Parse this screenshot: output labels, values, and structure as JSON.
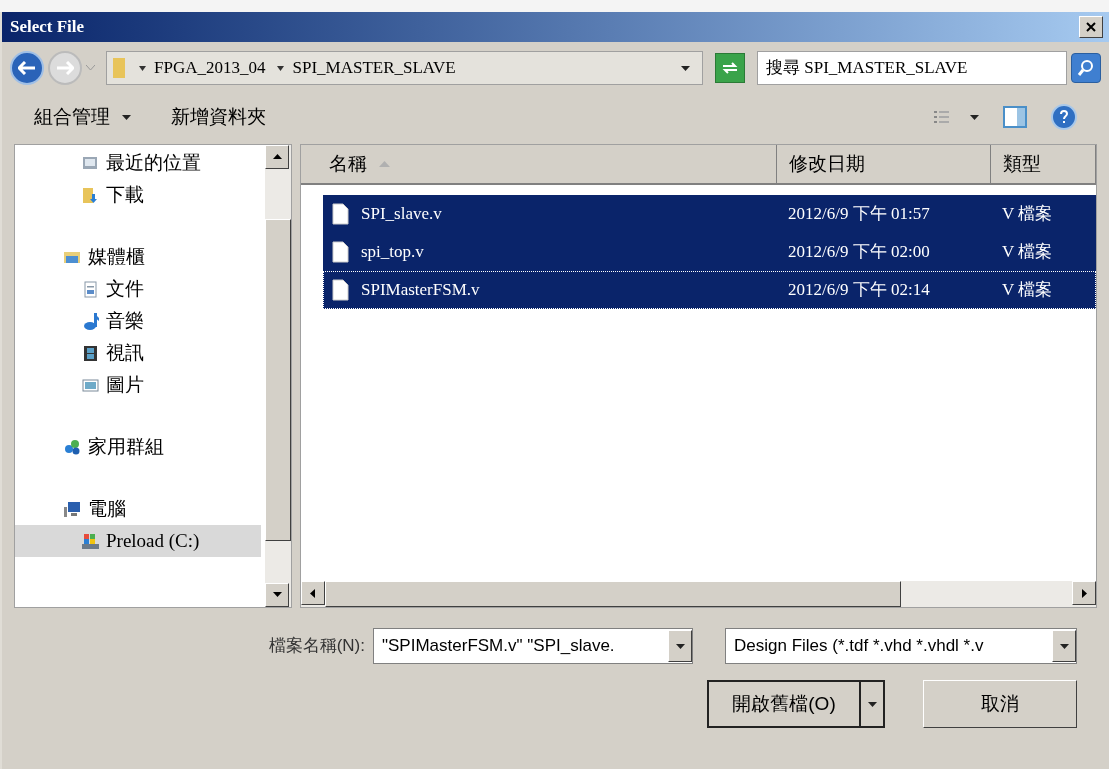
{
  "window": {
    "title": "Select File"
  },
  "address": {
    "path": [
      "FPGA_2013_04",
      "SPI_MASTER_SLAVE"
    ],
    "search_placeholder": "搜尋 SPI_MASTER_SLAVE"
  },
  "toolbar": {
    "buttons": [
      {
        "label": "組合管理",
        "dropdown": true
      },
      {
        "label": "新增資料夾",
        "dropdown": false
      }
    ]
  },
  "sidebar": {
    "sections": [
      {
        "children": [
          {
            "label": "最近的位置",
            "kind": "recent",
            "selected": false
          },
          {
            "label": "下載",
            "kind": "download",
            "selected": false
          }
        ]
      },
      {
        "label": "媒體櫃",
        "kind": "library",
        "selected": false,
        "children": [
          {
            "label": "文件",
            "kind": "document",
            "selected": false
          },
          {
            "label": "音樂",
            "kind": "music",
            "selected": false
          },
          {
            "label": "視訊",
            "kind": "video",
            "selected": false
          },
          {
            "label": "圖片",
            "kind": "image",
            "selected": false
          }
        ]
      },
      {
        "label": "家用群組",
        "kind": "homegroup",
        "selected": false
      },
      {
        "label": "電腦",
        "kind": "computer",
        "selected": false,
        "children": [
          {
            "label": "Preload (C:)",
            "kind": "drive",
            "selected": true
          }
        ]
      }
    ]
  },
  "table": {
    "columns": [
      {
        "label": "名稱",
        "sorted": true
      },
      {
        "label": "修改日期",
        "sorted": false
      },
      {
        "label": "類型",
        "sorted": false
      }
    ],
    "rows": [
      {
        "name": "SPI_slave.v",
        "modified": "2012/6/9 下午 01:57",
        "type": "V 檔案",
        "selected": true,
        "focused": false
      },
      {
        "name": "spi_top.v",
        "modified": "2012/6/9 下午 02:00",
        "type": "V 檔案",
        "selected": true,
        "focused": false
      },
      {
        "name": "SPIMasterFSM.v",
        "modified": "2012/6/9 下午 02:14",
        "type": "V 檔案",
        "selected": true,
        "focused": true
      }
    ]
  },
  "footer": {
    "filename_label": "檔案名稱(N):",
    "filename_value": "\"SPIMasterFSM.v\" \"SPI_slave.",
    "filter_value": "Design Files (*.tdf *.vhd *.vhdl *.v",
    "open_button": "開啟舊檔(O)",
    "cancel_button": "取消"
  }
}
